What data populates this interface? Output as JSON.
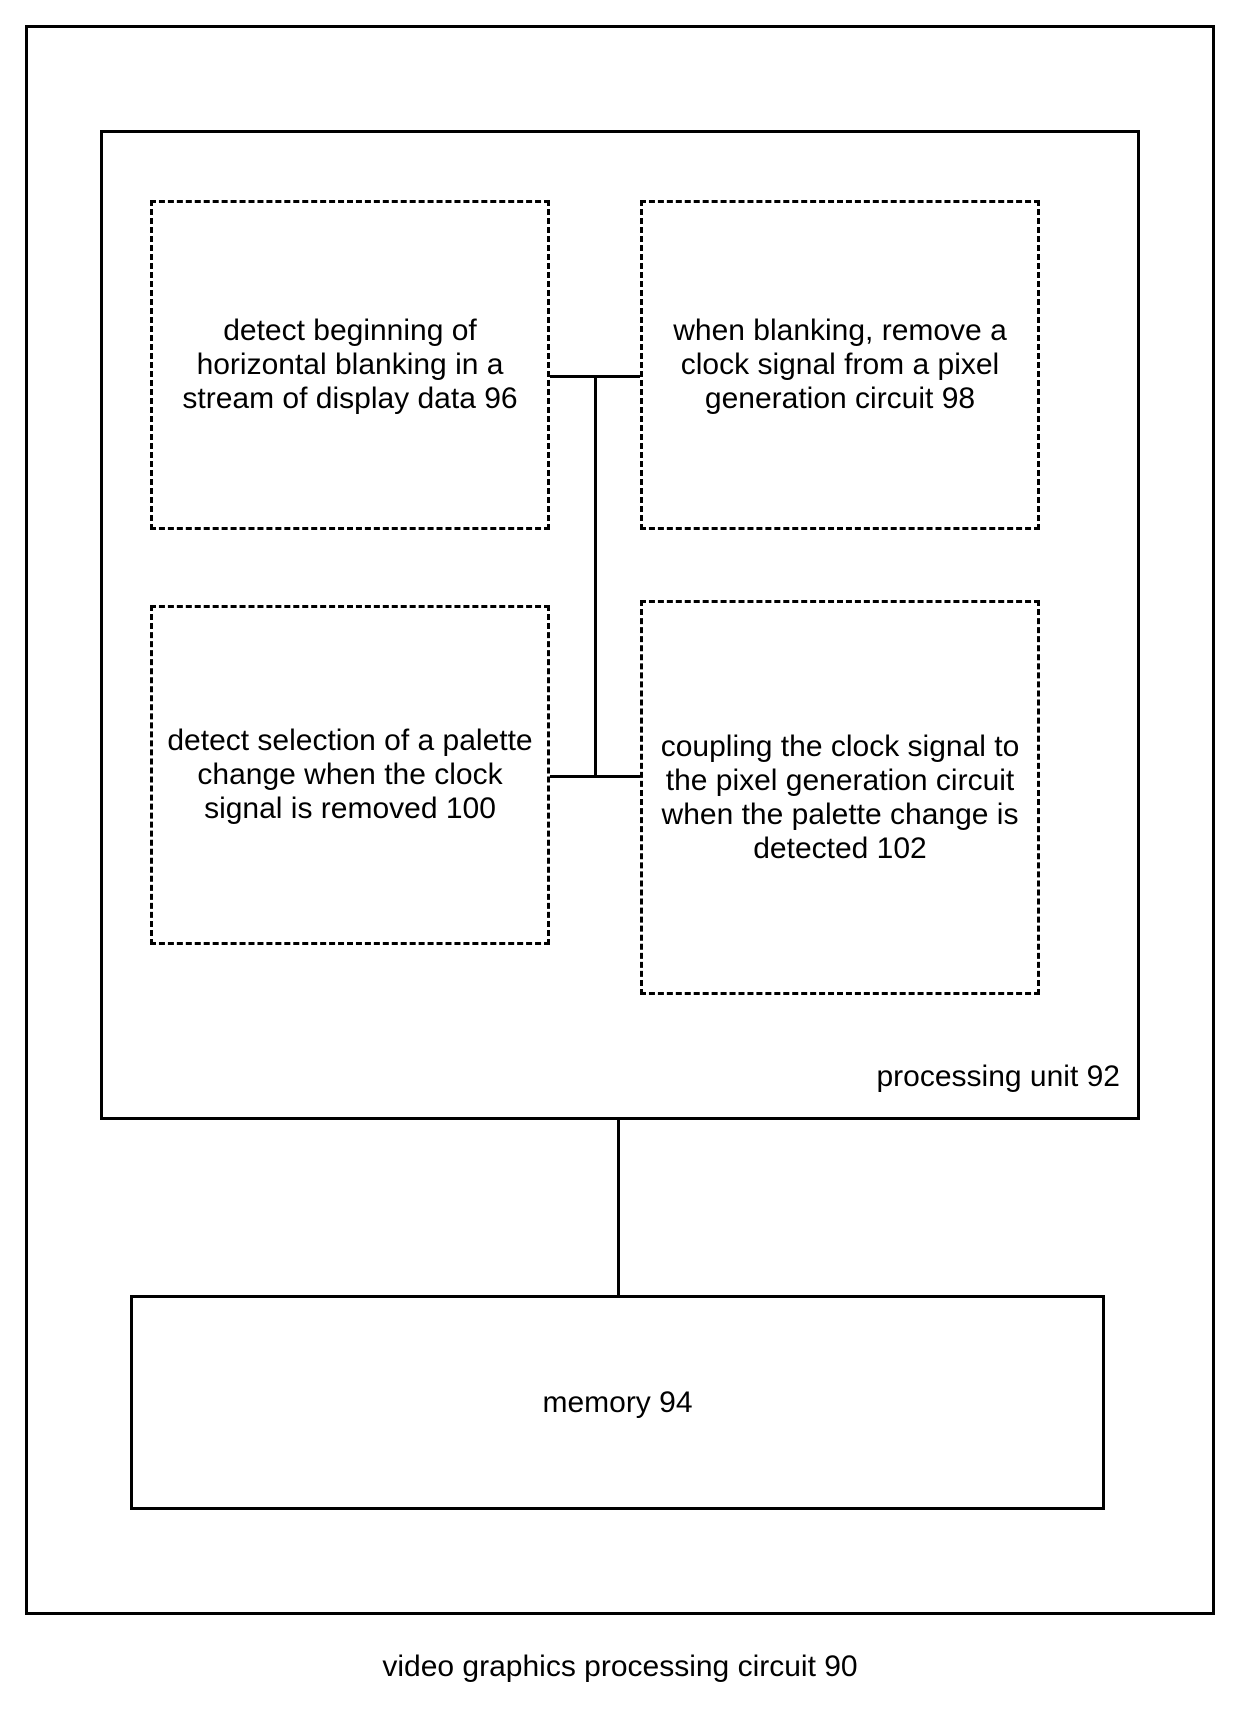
{
  "caption": "video graphics processing circuit 90",
  "processing_unit_label": "processing unit 92",
  "memory_label": "memory 94",
  "boxes": {
    "b96": "detect beginning of horizontal blanking in a stream of display data 96",
    "b98": "when blanking, remove a clock signal from a pixel generation circuit 98",
    "b100": "detect selection of a palette change when the clock signal is removed 100",
    "b102": "coupling the clock signal to the pixel generation circuit when the palette change is detected 102"
  }
}
